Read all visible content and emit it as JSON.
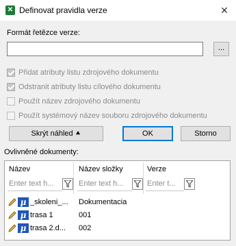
{
  "window": {
    "title": "Definovat pravidla verze",
    "close_symbol": "✕"
  },
  "format": {
    "label": "Formát řetězce verze:",
    "value": "",
    "browse_label": "..."
  },
  "options": [
    {
      "label": "Přidat atributy listu zdrojového dokumentu",
      "checked": true
    },
    {
      "label": "Odstranit atributy listu cílového dokumentu",
      "checked": true
    },
    {
      "label": "Použít název zdrojového dokumentu",
      "checked": false
    },
    {
      "label": "Použít systémový název souboru zdrojového dokumentu",
      "checked": false
    }
  ],
  "buttons": {
    "hide_preview": "Skrýt náhled ⯅",
    "ok": "OK",
    "cancel": "Storno"
  },
  "affected": {
    "label": "Ovlivněné dokumenty:",
    "columns": [
      "Název",
      "Název složky",
      "Verze"
    ],
    "filter_placeholders": [
      "Enter text h...",
      "Enter text h...",
      "Enter t..."
    ],
    "rows": [
      {
        "name": "_skoleni_...",
        "folder": "Dokumentacia",
        "version": ""
      },
      {
        "name": "trasa 1",
        "folder": "001",
        "version": ""
      },
      {
        "name": "trasa 2.d...",
        "folder": "002",
        "version": ""
      }
    ]
  },
  "colors": {
    "accent": "#0078d7",
    "app_icon": "#1d7a3a",
    "doc_icon": "#1f56b8"
  }
}
